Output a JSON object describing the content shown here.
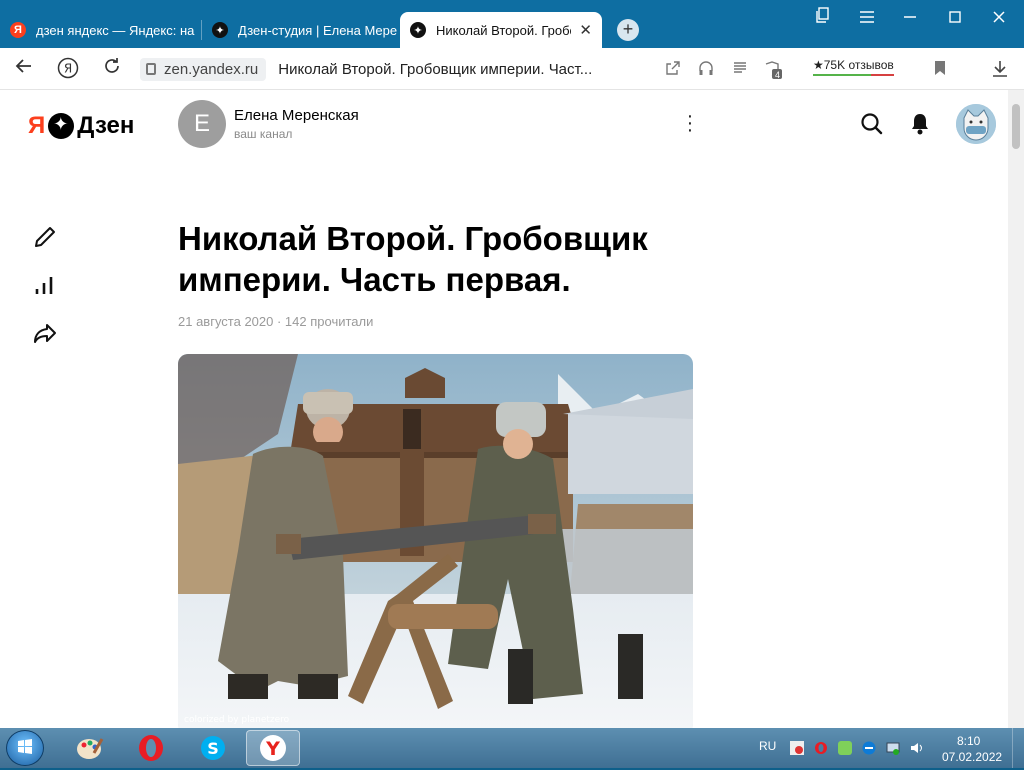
{
  "browser": {
    "tabs": [
      {
        "label": "дзен яндекс — Яндекс: на",
        "favicon": "yandex-icon"
      },
      {
        "label": "Дзен-студия | Елена Мерен",
        "favicon": "zen-icon"
      },
      {
        "label": "Николай Второй. Гробовщ",
        "favicon": "zen-icon",
        "active": true
      }
    ],
    "address": {
      "domain": "zen.yandex.ru",
      "page_title": "Николай Второй. Гробовщик империи. Част..."
    },
    "tab_badge_count": "4",
    "reviews_label": "★75K отзывов"
  },
  "header": {
    "logo_ya": "Я",
    "logo_word": "Дзен",
    "channel_initial": "E",
    "channel_name": "Елена Меренская",
    "channel_sub": "ваш канал"
  },
  "article": {
    "title": "Николай Второй. Гробовщик империи. Часть первая.",
    "meta": "21 августа 2020 · 142 прочитали",
    "photo_credit": "colorized by planetzero"
  },
  "taskbar": {
    "lang": "RU",
    "time": "8:10",
    "date": "07.02.2022"
  },
  "colors": {
    "tabbar": "#0e6ea2",
    "yandex_red": "#fc3f1d",
    "taskbar": "#4a7ea3"
  }
}
